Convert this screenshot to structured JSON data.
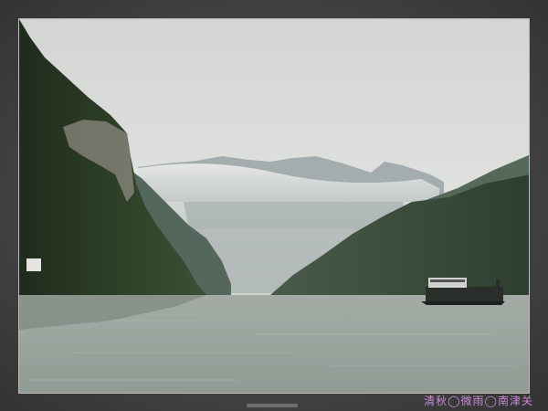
{
  "signature": {
    "text": "清秋◯微雨◯南津关",
    "color": "#c78bd6"
  },
  "scene": {
    "sky_color": "#d6d8d6",
    "water_color": "#a9b0a8",
    "left_cliff_color": "#2b3a26",
    "right_mountain_color": "#3a4a3a",
    "mist_color": "#e2e4e2"
  }
}
